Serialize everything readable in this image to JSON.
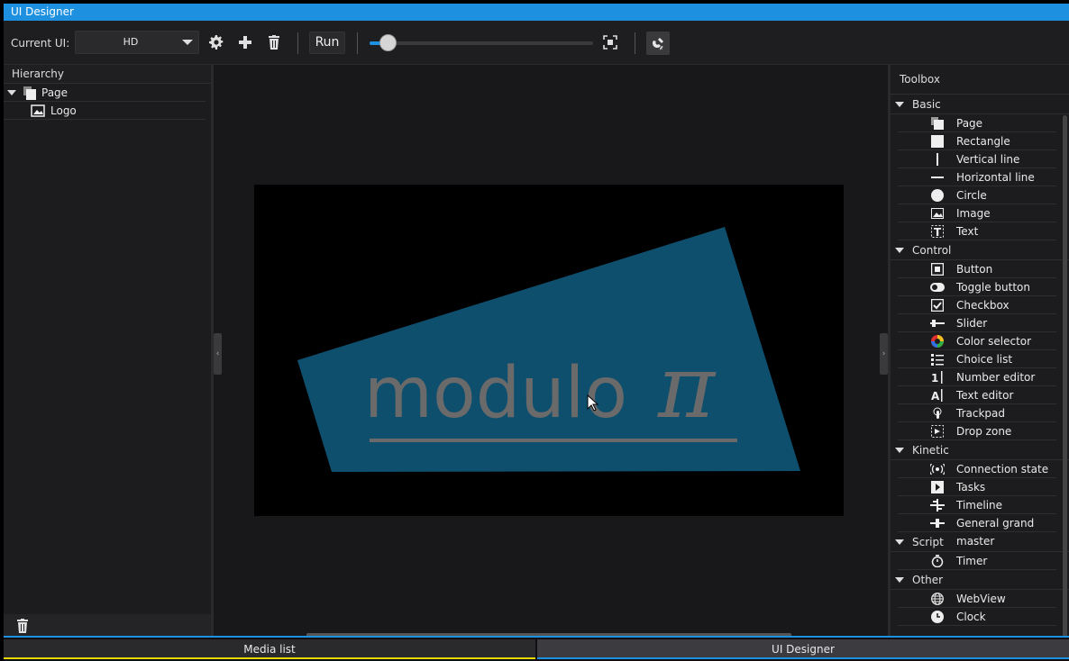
{
  "window": {
    "title": "UI Designer"
  },
  "toolbar": {
    "current_ui_label": "Current UI:",
    "current_ui_value": "HD",
    "settings_icon": "gear-icon",
    "add_icon": "plus-icon",
    "delete_icon": "trash-icon",
    "run_label": "Run",
    "zoom_level": 0.08,
    "fit_icon": "fit-screen-icon",
    "magnet_icon": "magnet-icon",
    "accent": "#1e90e0"
  },
  "hierarchy": {
    "title": "Hierarchy",
    "items": [
      {
        "label": "Page",
        "icon": "page-icon",
        "expanded": true
      },
      {
        "label": "Logo",
        "icon": "image-icon"
      }
    ]
  },
  "canvas": {
    "logo_text": "modulo",
    "logo_symbol": "π",
    "logo_color": "#0f4f6e"
  },
  "toolbox": {
    "title": "Toolbox",
    "categories": [
      {
        "name": "Basic",
        "items": [
          "Page",
          "Rectangle",
          "Vertical line",
          "Horizontal line",
          "Circle",
          "Image",
          "Text"
        ]
      },
      {
        "name": "Control",
        "items": [
          "Button",
          "Toggle button",
          "Checkbox",
          "Slider",
          "Color selector",
          "Choice list",
          "Number editor",
          "Text editor",
          "Trackpad",
          "Drop zone"
        ]
      },
      {
        "name": "Kinetic",
        "items": [
          "Connection state",
          "Tasks",
          "Timeline",
          "General grand master"
        ]
      },
      {
        "name": "Script",
        "items": [
          "Timer"
        ]
      },
      {
        "name": "Other",
        "items": [
          "WebView",
          "Clock"
        ]
      }
    ]
  },
  "tabs": {
    "media_list": "Media list",
    "ui_designer": "UI Designer"
  }
}
